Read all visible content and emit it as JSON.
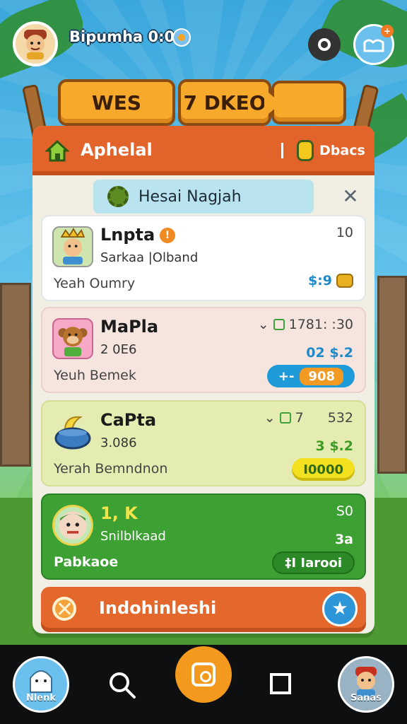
{
  "top_bar": {
    "player_name": "Bipumha",
    "timer": "0:00"
  },
  "sign": {
    "left_text": "WES",
    "right_text": "7 DKEO"
  },
  "panel": {
    "title": "Aphelal",
    "deals_label": "Dbacs",
    "subtitle": "Hesai Nagjah"
  },
  "cards": [
    {
      "title": "Lnpta",
      "sub": "Sarkaa |Olband",
      "foot_label": "Yeah",
      "foot_value": "Oumry",
      "right": "10",
      "price": "$:9"
    },
    {
      "title": "MaPla",
      "sub": "2 0E6",
      "foot_label": "Yeuh",
      "foot_value": "Bemek",
      "right": "1781: :30",
      "price": "02 $.2",
      "pill_left": "+-",
      "pill_value": "908"
    },
    {
      "title": "CaPta",
      "sub": "3.086",
      "foot_label": "Yerah",
      "foot_value": "Bemndnon",
      "right_a": "7",
      "right_b": "532",
      "price": "3 $.2",
      "pill_value": "I0000"
    },
    {
      "title": "1, K",
      "sub": "Snilblkaad",
      "foot_label": "Pabkaoe",
      "right": "S0",
      "price": "3a",
      "pill_value": "‡I Iarooi"
    }
  ],
  "bottom_button": {
    "label": "Indohinleshi"
  },
  "nav": {
    "left_label": "Nlenk",
    "right_label": "Sanas"
  },
  "colors": {
    "header_orange": "#e3642a",
    "card_green": "#3da033",
    "accent_blue": "#1f9bd9"
  }
}
